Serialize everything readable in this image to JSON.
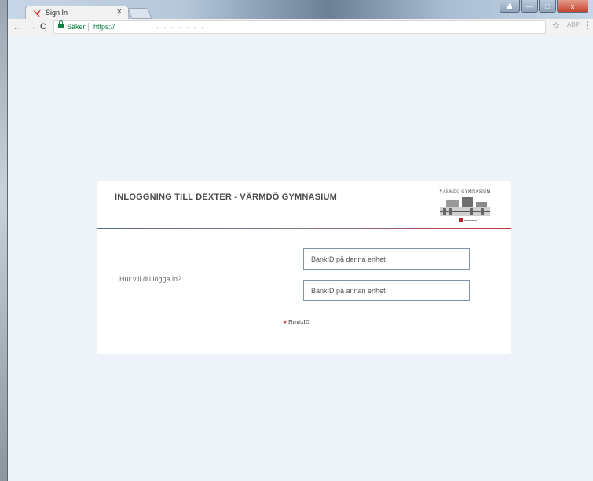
{
  "browser": {
    "tab": {
      "title": "Sign In",
      "close_glyph": "×",
      "favicon": "phenixid-bird-icon"
    },
    "nav": {
      "back": "←",
      "forward": "→",
      "reload": "C"
    },
    "address": {
      "security_label": "Säker",
      "url_prefix": "https://",
      "url_rest": "·  ·  ·  ·  ·  ·  ·"
    },
    "actions": {
      "bookmark": "☆",
      "extension": "ABP",
      "menu": "⋮"
    },
    "window_buttons": {
      "minimize": "—",
      "maximize": "□",
      "close": "x"
    }
  },
  "page": {
    "background": "#eef3fa",
    "title": "INLOGGNING TILL DEXTER - VÄRMDÖ GYMNASIUM",
    "logo": {
      "text": "VÄRMDÖ GYMNASIUM",
      "icon": "school-building-logo"
    },
    "question": "Hur vill du logga in?",
    "options": [
      {
        "label": "BankID på denna enhet"
      },
      {
        "label": "BankID på annan enhet"
      }
    ],
    "footer_brand": "PhenixID",
    "colors": {
      "divider_left": "#5a6b82",
      "divider_right": "#c2303a",
      "option_border": "#7d94ab"
    }
  }
}
